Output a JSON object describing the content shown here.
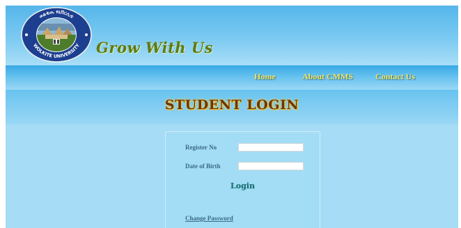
{
  "header": {
    "seal_text": "WOLKITE UNIVERSITY",
    "seal_amharic": "ወልቂጤ ዩኒቨርሲቲ",
    "motto": "Grow With Us"
  },
  "nav": {
    "items": [
      {
        "label": "Home"
      },
      {
        "label": "About CMMS"
      },
      {
        "label": "Contact Us"
      }
    ]
  },
  "page": {
    "title": "STUDENT LOGIN"
  },
  "form": {
    "register_label": "Register No",
    "register_value": "",
    "dob_label": "Date of Birth",
    "dob_value": "",
    "login_label": "Login",
    "change_password_label": "Change Password"
  },
  "colors": {
    "background": "#a6dcf5",
    "nav_text": "#f3e25a",
    "title_text": "#6a3608",
    "label_text": "#3a6a86"
  }
}
